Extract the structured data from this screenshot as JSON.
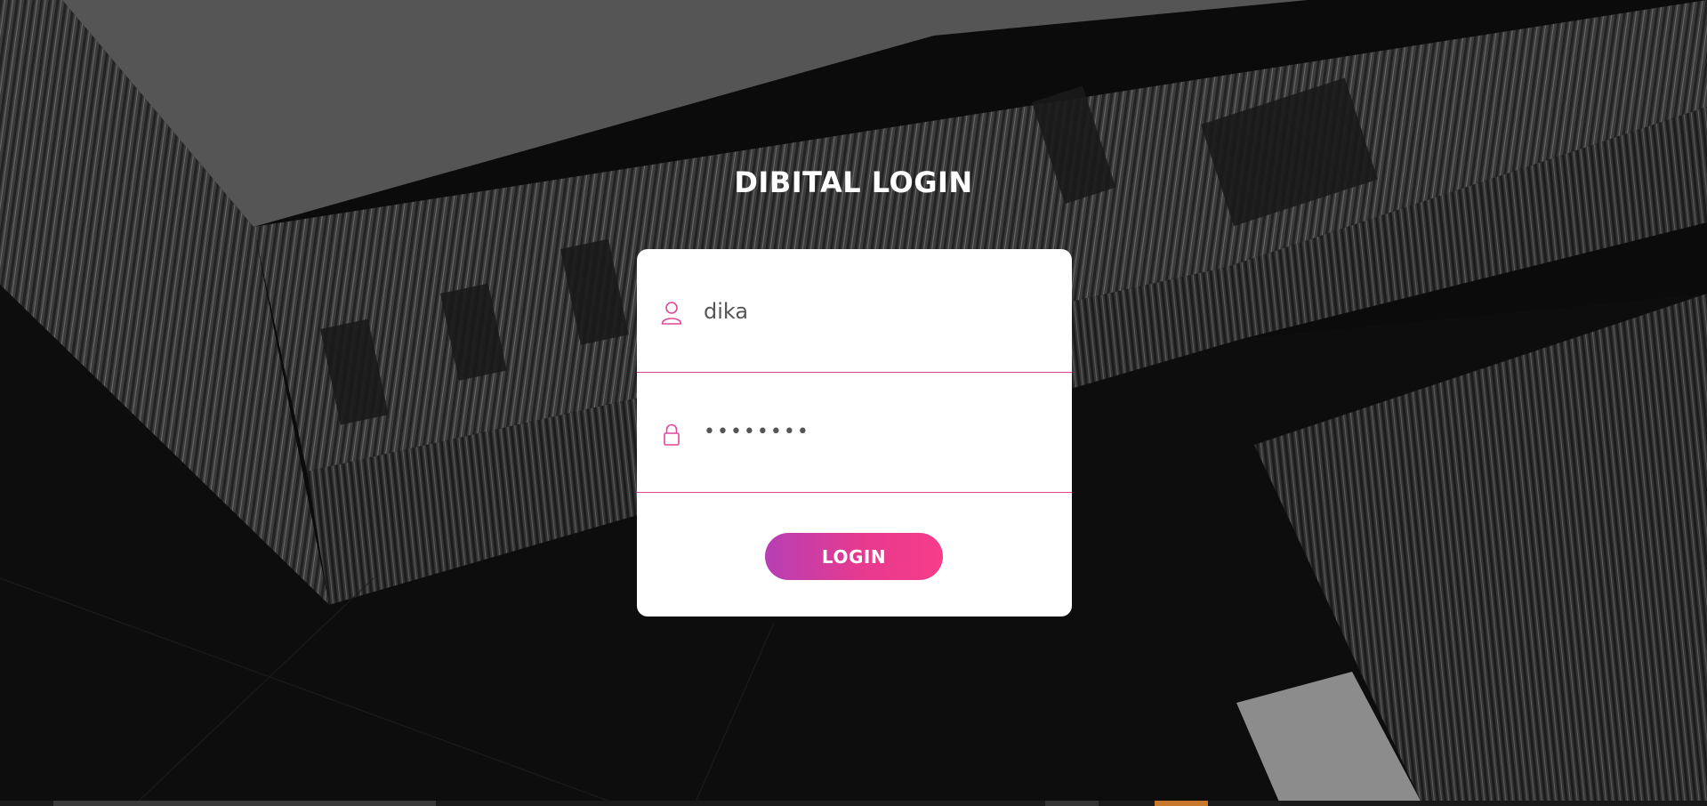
{
  "page": {
    "title": "DIBITAL LOGIN"
  },
  "form": {
    "username": {
      "value": "dika",
      "icon": "user-icon"
    },
    "password": {
      "value": "••••••••",
      "icon": "lock-icon"
    },
    "submit_label": "LOGIN"
  },
  "colors": {
    "accent": "#e73a8e",
    "accent_start": "#b63fb5",
    "card": "#ffffff",
    "background": "#0a0a0a"
  }
}
